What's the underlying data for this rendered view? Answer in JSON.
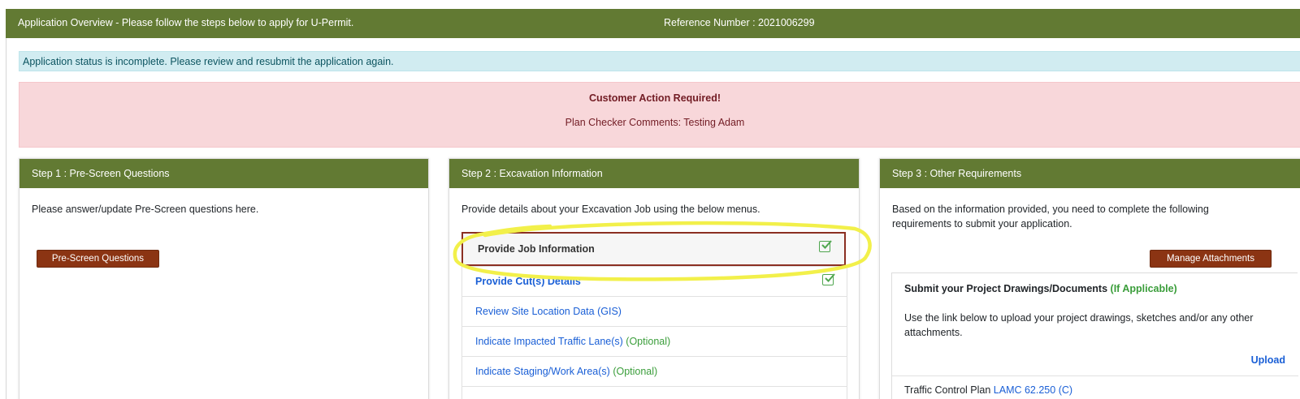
{
  "header": {
    "title": "Application Overview - Please follow the steps below to apply for U-Permit.",
    "reference": "Reference Number : 2021006299"
  },
  "alerts": {
    "info": "Application status is incomplete. Please review and resubmit the application again.",
    "danger_heading": "Customer Action Required!",
    "danger_comments": "Plan Checker Comments: Testing Adam"
  },
  "step1": {
    "title": "Step 1 : Pre-Screen Questions",
    "text": "Please answer/update Pre-Screen questions here.",
    "button": "Pre-Screen Questions"
  },
  "step2": {
    "title": "Step 2 : Excavation Information",
    "text": "Provide details about your Excavation Job using the below menus.",
    "items": [
      {
        "label": "Provide Job Information",
        "optional": "",
        "checked": "checkbox-checked-icon"
      },
      {
        "label": "Provide Cut(s) Details",
        "optional": "",
        "checked": "checkbox-checked-icon"
      },
      {
        "label": "Review Site Location Data (GIS)",
        "optional": ""
      },
      {
        "label": "Indicate Impacted Traffic Lane(s)",
        "optional": "(Optional)"
      },
      {
        "label": "Indicate Staging/Work Area(s)",
        "optional": "(Optional)"
      }
    ]
  },
  "step3": {
    "title": "Step 3 : Other Requirements",
    "text": "Based on the information provided, you need to complete the following requirements to submit your application.",
    "button": "Manage Attachments",
    "submit": {
      "heading": "Submit your Project Drawings/Documents",
      "heading_note": "(If Applicable)",
      "description": "Use the link below to upload your project drawings, sketches and/or any other attachments.",
      "upload": "Upload",
      "traffic_label": "Traffic Control Plan",
      "traffic_link": "LAMC 62.250 (C)"
    }
  },
  "colors": {
    "header_green": "#627a33",
    "button_maroon": "#8b3413",
    "link_blue": "#1a5fd6",
    "optional_green": "#3a9d3a",
    "highlight_yellow": "#f2f04a"
  }
}
